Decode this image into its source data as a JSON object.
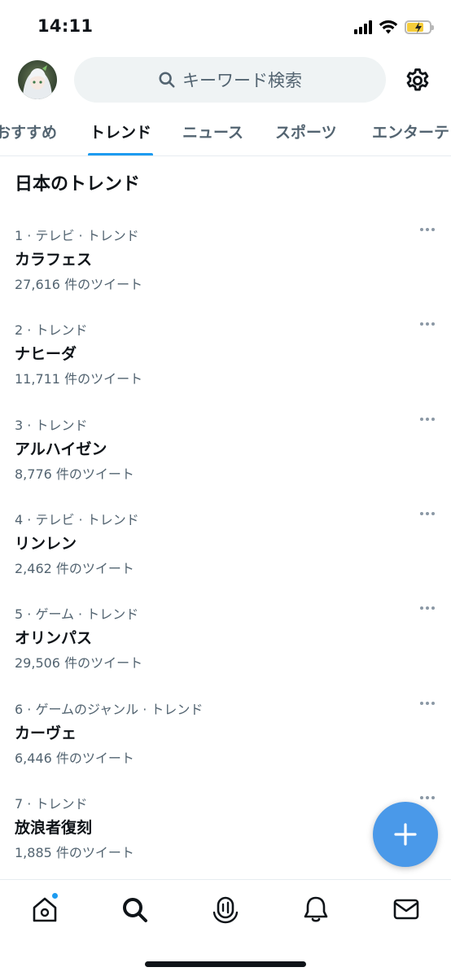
{
  "status": {
    "time": "14:11"
  },
  "search": {
    "placeholder": "キーワード検索"
  },
  "tabs": [
    {
      "label": "おすすめ",
      "active": false
    },
    {
      "label": "トレンド",
      "active": true
    },
    {
      "label": "ニュース",
      "active": false
    },
    {
      "label": "スポーツ",
      "active": false
    },
    {
      "label": "エンターテ",
      "active": false
    }
  ],
  "section": {
    "title": "日本のトレンド"
  },
  "trends": [
    {
      "meta": "1 · テレビ · トレンド",
      "name": "カラフェス",
      "count": "27,616 件のツイート"
    },
    {
      "meta": "2 · トレンド",
      "name": "ナヒーダ",
      "count": "11,711 件のツイート"
    },
    {
      "meta": "3 · トレンド",
      "name": "アルハイゼン",
      "count": "8,776 件のツイート"
    },
    {
      "meta": "4 · テレビ · トレンド",
      "name": "リンレン",
      "count": "2,462 件のツイート"
    },
    {
      "meta": "5 · ゲーム · トレンド",
      "name": "オリンパス",
      "count": "29,506 件のツイート"
    },
    {
      "meta": "6 · ゲームのジャンル · トレンド",
      "name": "カーヴェ",
      "count": "6,446 件のツイート"
    },
    {
      "meta": "7 · トレンド",
      "name": "放浪者復刻",
      "count": "1,885 件のツイート"
    }
  ],
  "icons": {
    "search": "search-icon",
    "settings": "gear-icon",
    "compose": "plus-icon",
    "nav": [
      "home-icon",
      "search-icon",
      "spaces-icon",
      "bell-icon",
      "mail-icon"
    ]
  },
  "colors": {
    "accent": "#1d9bf0",
    "fab": "#4a99e9",
    "secondary_text": "#536471"
  }
}
